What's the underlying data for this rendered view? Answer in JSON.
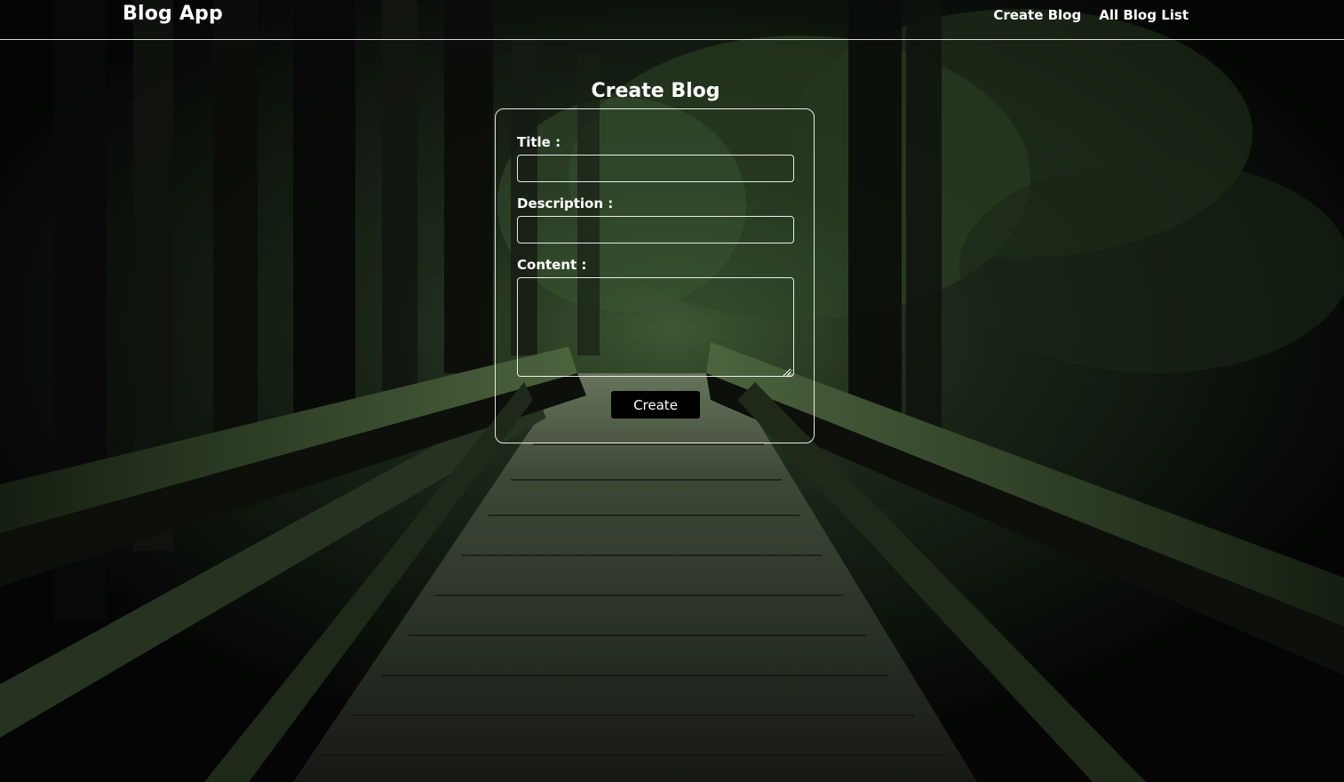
{
  "navbar": {
    "brand": "Blog App",
    "links": [
      {
        "label": "Create Blog"
      },
      {
        "label": "All Blog List"
      }
    ]
  },
  "form": {
    "title": "Create Blog",
    "fields": {
      "title": {
        "label": "Title :",
        "value": ""
      },
      "description": {
        "label": "Description :",
        "value": ""
      },
      "content": {
        "label": "Content :",
        "value": ""
      }
    },
    "submit_label": "Create"
  },
  "background": {
    "description_icon": "forest-bridge-background"
  },
  "colors": {
    "text": "#ffffff",
    "button_bg": "#000000",
    "border": "#ffffff",
    "forest_green": "#3f5a34"
  }
}
